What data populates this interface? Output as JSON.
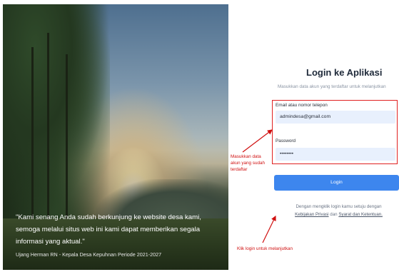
{
  "background": {
    "quote_lines": [
      "\"Kami senang Anda sudah berkunjung ke website desa kami,",
      "semoga melalui situs web ini kami dapat memberikan segala",
      "informasi yang aktual.\""
    ],
    "author": "Ujang Herman RN - Kepala Desa Kepuhnan Periode 2021-2027"
  },
  "login": {
    "title": "Login ke Aplikasi",
    "subtitle": "Masukkan data akun yang terdaftar untuk melanjutkan",
    "email_label": "Email atau nomor telepon",
    "email_value": "admindesa@gmail.com",
    "password_label": "Password",
    "password_value": "••••••••",
    "button_label": "Login",
    "agree_prefix": "Dengan mengklik login kamu setuju dengan",
    "privacy_link": "Kebijakan Privasi",
    "agree_and": "dan",
    "terms_link": "Syarat dan Ketentuan."
  },
  "annotations": {
    "form_note_lines": [
      "Masukkan data",
      "akun yang sudah",
      "terdaftar"
    ],
    "button_note": "Klik login untuk melanjutkan"
  },
  "colors": {
    "annotation": "#d01010",
    "button": "#3d86ee",
    "input_background": "#e8f0fd"
  }
}
